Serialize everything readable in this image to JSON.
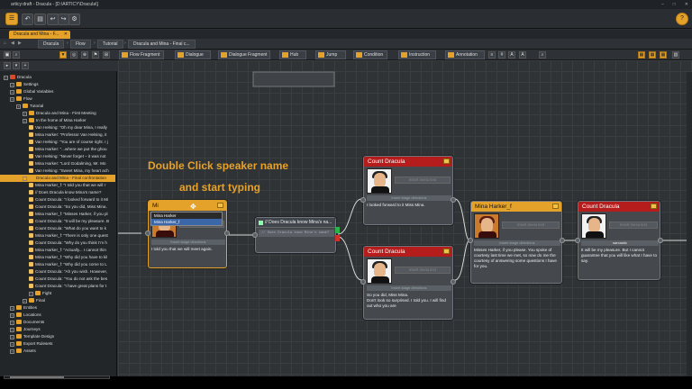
{
  "window": {
    "title": "articy:draft - Dracula - [D:\\ARTICY\\Dracula\\]",
    "min": "–",
    "max": "□",
    "close": "✕"
  },
  "tab": {
    "label": "Dracula and Mina - F...",
    "close": "✕"
  },
  "breadcrumbs": [
    "Dracula",
    "Flow",
    "Tutorial",
    "Dracula and Mina - Final c..."
  ],
  "toolbar": [
    "Flow Fragment",
    "Dialogue",
    "Dialogue Fragment",
    "Hub",
    "Jump",
    "Condition",
    "Instruction",
    "Annotation"
  ],
  "tree": [
    {
      "label": "Dracula",
      "level": 0,
      "icon": "red"
    },
    {
      "label": "Settings",
      "level": 1,
      "icon": "folder"
    },
    {
      "label": "Global Variables",
      "level": 1,
      "icon": "folder"
    },
    {
      "label": "Flow",
      "level": 1,
      "icon": "folder"
    },
    {
      "label": "Tutorial",
      "level": 2,
      "icon": "folder"
    },
    {
      "label": "Dracula and Mina - First Meeting",
      "level": 3,
      "icon": "folder"
    },
    {
      "label": "In the home of Mina Harker",
      "level": 3,
      "icon": "folder"
    },
    {
      "label": "Van Helsing: \"Oh my dear Mina, I really",
      "level": 4,
      "icon": "file"
    },
    {
      "label": "Mina Harker: \"Professor Van Helsing, it",
      "level": 4,
      "icon": "file"
    },
    {
      "label": "Van Helsing: \"You are of course right. I j",
      "level": 4,
      "icon": "file"
    },
    {
      "label": "Mina Harker: \"...where we put the ghou",
      "level": 4,
      "icon": "file"
    },
    {
      "label": "Van Helsing: \"Never forget – it was not",
      "level": 4,
      "icon": "file"
    },
    {
      "label": "Mina Harker: \"Lord Godalming, Mr. Mo",
      "level": 4,
      "icon": "file"
    },
    {
      "label": "Van Helsing: \"Sweet Mina, my heart ach",
      "level": 4,
      "icon": "file"
    },
    {
      "label": "Dracula and Mina - Final confrontation",
      "level": 3,
      "icon": "folder",
      "selected": true
    },
    {
      "label": "Mina Harker_f: \"I told you that we will r",
      "level": 4,
      "icon": "file"
    },
    {
      "label": "// Does Dracula know Mina's name?",
      "level": 4,
      "icon": "file"
    },
    {
      "label": "Count Dracula: \"I looked forward to it Mi",
      "level": 4,
      "icon": "file"
    },
    {
      "label": "Count Dracula: \"So you did, Miss Mina.",
      "level": 4,
      "icon": "file"
    },
    {
      "label": "Mina Harker_f: \"Misses Harker, if you pl",
      "level": 4,
      "icon": "file"
    },
    {
      "label": "Count Dracula: \"It will be my pleasure. B",
      "level": 4,
      "icon": "file"
    },
    {
      "label": "Count Dracula: \"What do you want to k",
      "level": 4,
      "icon": "file"
    },
    {
      "label": "Mina Harker_f: \"There is only one quest",
      "level": 4,
      "icon": "file"
    },
    {
      "label": "Count Dracula: \"Why do you think I'm h",
      "level": 4,
      "icon": "file"
    },
    {
      "label": "Mina Harker_f: \"Actually... I cannot thin",
      "level": 4,
      "icon": "file"
    },
    {
      "label": "Mina Harker_f: \"Why did you have to kil",
      "level": 4,
      "icon": "file"
    },
    {
      "label": "Mina Harker_f: \"Why did you come to L",
      "level": 4,
      "icon": "file"
    },
    {
      "label": "Count Dracula: \"Ah you wish. However,",
      "level": 4,
      "icon": "file"
    },
    {
      "label": "Count Dracula: \"You do not ask the bes",
      "level": 4,
      "icon": "file"
    },
    {
      "label": "Count Dracula: \"I have great plans for t",
      "level": 4,
      "icon": "file"
    },
    {
      "label": "Fight",
      "level": 4,
      "icon": "folder"
    },
    {
      "label": "Final",
      "level": 3,
      "icon": "folder"
    },
    {
      "label": "Entities",
      "level": 1,
      "icon": "folder"
    },
    {
      "label": "Locations",
      "level": 1,
      "icon": "folder"
    },
    {
      "label": "Documents",
      "level": 1,
      "icon": "folder"
    },
    {
      "label": "Journeys",
      "level": 1,
      "icon": "folder"
    },
    {
      "label": "Template Design",
      "level": 1,
      "icon": "folder"
    },
    {
      "label": "Export Rulesets",
      "level": 1,
      "icon": "folder"
    },
    {
      "label": "Assets",
      "level": 1,
      "icon": "folder"
    }
  ],
  "annotation": {
    "line1": "Double Click speaker name",
    "line2": "and start typing"
  },
  "nodes": {
    "mina_edit": {
      "speaker": "Mi",
      "dropdown": [
        "Mina Harker",
        "Mina Harker_f"
      ],
      "menu": "Insert menu text",
      "stage": "Insert stage directions",
      "text": "I told you that we will meet again."
    },
    "condition": {
      "title": "// Does Dracula know Mina's na...",
      "code": "// Does Dracula know Mina's name?"
    },
    "dracula_top": {
      "speaker": "Count Dracula",
      "menu": "Insert menu text",
      "stage": "Insert stage directions",
      "text": "I looked forward to it Miss Mina."
    },
    "dracula_bottom": {
      "speaker": "Count Dracula",
      "menu": "Insert menu text",
      "stage": "Insert stage directions",
      "text": "So you did, Miss Mina.\nDon't look so surprised. I told you. I will find out who you are"
    },
    "mina_f": {
      "speaker": "Mina Harker_f",
      "menu": "Insert menu text",
      "stage": "Insert stage directions",
      "text": "Misses Harker, if you please. You spoke of courtesy last time we met, so now do me the courtesy of answering some questions I have for you."
    },
    "dracula_right": {
      "speaker": "Count Dracula",
      "menu": "Insert menu text",
      "stage": "sarcastic",
      "text": "It will be my pleasure. But I cannot guarantee that you will like what I have to say."
    }
  },
  "colors": {
    "accent": "#e4a22a",
    "dracula": "#b51c1c"
  }
}
